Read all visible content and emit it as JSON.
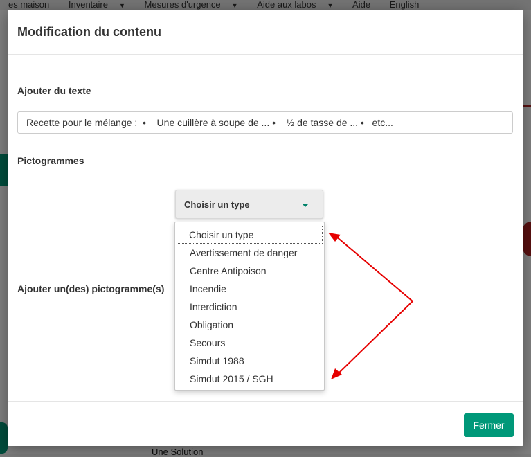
{
  "background": {
    "nav": [
      {
        "label": "es maison",
        "caret": false
      },
      {
        "label": "Inventaire",
        "caret": true
      },
      {
        "label": "Mesures d'urgence",
        "caret": true
      },
      {
        "label": "Aide aux labos",
        "caret": true
      },
      {
        "label": "Aide",
        "caret": false
      },
      {
        "label": "English",
        "caret": false
      }
    ],
    "bottom_text": "Une Solution"
  },
  "modal": {
    "title": "Modification du contenu",
    "text_section_label": "Ajouter du texte",
    "text_value": "Recette pour le mélange :  •    Une cuillère à soupe de ... •    ½ de tasse de ... •   etc...",
    "pictogram_label": "Pictogrammes",
    "add_pictograms_label": "Ajouter un(des) pictogramme(s)",
    "select": {
      "selected": "Choisir un type",
      "options": [
        "Choisir un type",
        "Avertissement de danger",
        "Centre Antipoison",
        "Incendie",
        "Interdiction",
        "Obligation",
        "Secours",
        "Simdut 1988",
        "Simdut 2015 / SGH"
      ]
    },
    "close_label": "Fermer"
  },
  "colors": {
    "accent": "#009879",
    "annotation_arrow": "#e60000"
  }
}
